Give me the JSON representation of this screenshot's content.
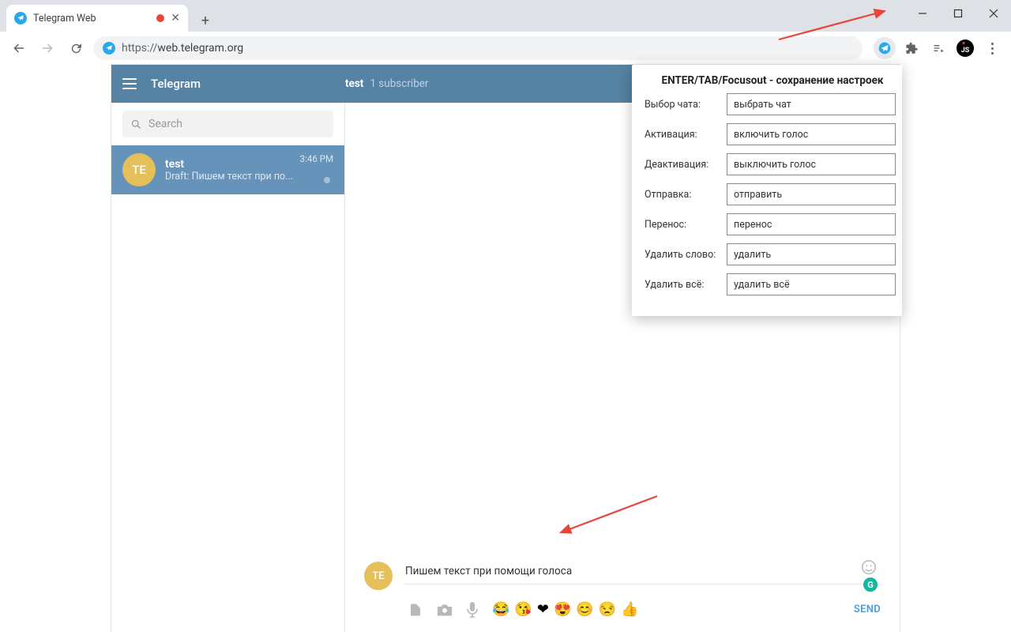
{
  "browser": {
    "tab_title": "Telegram Web",
    "url_protocol": "https://",
    "url_rest": "web.telegram.org"
  },
  "telegram": {
    "app_title": "Telegram",
    "header": {
      "chat": "test",
      "sub": "1 subscriber"
    },
    "search_placeholder": "Search",
    "chat": {
      "avatar": "TE",
      "name": "test",
      "draft_prefix": "Draft: ",
      "draft_text": "Пишем текст при по...",
      "time": "3:46 PM"
    },
    "composer": {
      "avatar": "TE",
      "text": "Пишем текст при помощи голоса",
      "grammarly": "G",
      "send": "SEND",
      "emojis": [
        "😂",
        "😘",
        "❤",
        "😍",
        "😊",
        "😒",
        "👍"
      ]
    }
  },
  "popup": {
    "title": "ENTER/TAB/Focusout - сохранение настроек",
    "rows": [
      {
        "label": "Выбор чата:",
        "value": "выбрать чат"
      },
      {
        "label": "Активация:",
        "value": "включить голос"
      },
      {
        "label": "Деактивация:",
        "value": "выключить голос"
      },
      {
        "label": "Отправка:",
        "value": "отправить"
      },
      {
        "label": "Перенос:",
        "value": "перенос"
      },
      {
        "label": "Удалить слово:",
        "value": "удалить"
      },
      {
        "label": "Удалить всё:",
        "value": "удалить всё"
      }
    ]
  },
  "avatar_js": "JS"
}
